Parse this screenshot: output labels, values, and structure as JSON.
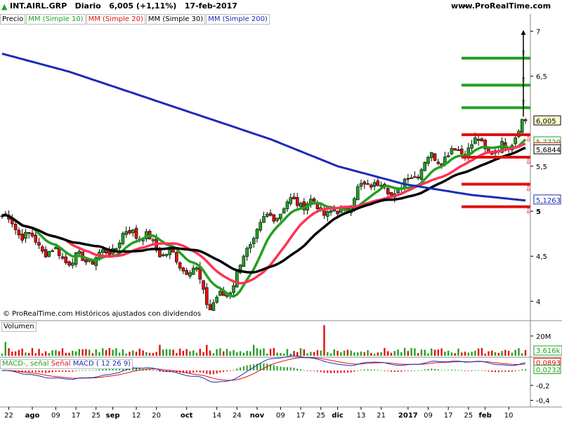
{
  "header": {
    "symbol": "INT.AIRL.GRP",
    "period": "Diario",
    "price_change": "6,005 (+1,11%)",
    "date": "17-feb-2017",
    "site": "www.ProRealTime.com"
  },
  "legend": {
    "price": "Precio",
    "ma10": "MM (Simple 10)",
    "ma20": "MM (Simple 20)",
    "ma30": "MM (Simple 30)",
    "ma200": "MM (Simple 200)"
  },
  "copyright": "© ProRealTime.com  Históricos ajustados con dividendos",
  "volume_label": "Volumen",
  "macd_labels": {
    "macd_signal": "MACD-, señal",
    "signal": "Señal",
    "macd": "MACD ( 12 26 9)"
  },
  "colors": {
    "up": "#22a022",
    "down": "#e01010",
    "ma10": "#22a022",
    "ma20": "#ff3355",
    "ma30": "#000000",
    "ma200": "#1c2bb8"
  },
  "chart_data": {
    "type": "line",
    "price_axis": {
      "ticks": [
        {
          "value": 7,
          "label": "7"
        },
        {
          "value": 6.5,
          "label": "6,5"
        },
        {
          "value": 5.5,
          "label": "5,5"
        },
        {
          "value": 5,
          "label": "5"
        },
        {
          "value": 4.5,
          "label": "4,5"
        },
        {
          "value": 4,
          "label": "4"
        }
      ],
      "ylim": [
        3.8,
        7.05
      ]
    },
    "price_tags": [
      {
        "value": 6.005,
        "label": "6,005",
        "color": "#000000",
        "bg": "#ffffcc"
      },
      {
        "value": 5.772,
        "label": "5,7720",
        "color": "#22a022",
        "bg": "#ffffff"
      },
      {
        "value": 5.7383,
        "label": "5,7383",
        "color": "#e01010",
        "bg": "#ffffff"
      },
      {
        "value": 5.6844,
        "label": "5,6844",
        "color": "#000000",
        "bg": "#ffffff"
      },
      {
        "value": 5.1263,
        "label": "5,1263",
        "color": "#1c2bb8",
        "bg": "#ffffff"
      }
    ],
    "x_axis": [
      {
        "label": "22",
        "i": 2
      },
      {
        "label": "ago",
        "i": 9
      },
      {
        "label": "09",
        "i": 16
      },
      {
        "label": "17",
        "i": 22
      },
      {
        "label": "25",
        "i": 28
      },
      {
        "label": "sep",
        "i": 33
      },
      {
        "label": "12",
        "i": 40
      },
      {
        "label": "20",
        "i": 46
      },
      {
        "label": "oct",
        "i": 55
      },
      {
        "label": "14",
        "i": 64
      },
      {
        "label": "24",
        "i": 70
      },
      {
        "label": "nov",
        "i": 76
      },
      {
        "label": "09",
        "i": 83
      },
      {
        "label": "17",
        "i": 89
      },
      {
        "label": "25",
        "i": 95
      },
      {
        "label": "dic",
        "i": 100
      },
      {
        "label": "13",
        "i": 107
      },
      {
        "label": "21",
        "i": 113
      },
      {
        "label": "2017",
        "i": 121
      },
      {
        "label": "09",
        "i": 127
      },
      {
        "label": "17",
        "i": 133
      },
      {
        "label": "25",
        "i": 139
      },
      {
        "label": "feb",
        "i": 144
      },
      {
        "label": "10",
        "i": 151
      }
    ],
    "bars": 157,
    "keypoints": [
      [
        0,
        4.95
      ],
      [
        8,
        4.7
      ],
      [
        14,
        4.55
      ],
      [
        22,
        4.45
      ],
      [
        30,
        4.5
      ],
      [
        39,
        4.8
      ],
      [
        46,
        4.6
      ],
      [
        52,
        4.45
      ],
      [
        58,
        4.3
      ],
      [
        62,
        3.95
      ],
      [
        66,
        4.05
      ],
      [
        70,
        4.3
      ],
      [
        76,
        4.8
      ],
      [
        82,
        5.0
      ],
      [
        88,
        5.12
      ],
      [
        94,
        5.05
      ],
      [
        100,
        4.95
      ],
      [
        106,
        5.2
      ],
      [
        110,
        5.35
      ],
      [
        116,
        5.2
      ],
      [
        120,
        5.3
      ],
      [
        126,
        5.55
      ],
      [
        134,
        5.65
      ],
      [
        142,
        5.75
      ],
      [
        148,
        5.65
      ],
      [
        152,
        5.82
      ],
      [
        156,
        6.0
      ]
    ],
    "lines": [
      {
        "name": "MM (Simple 10)",
        "period": 10
      },
      {
        "name": "MM (Simple 20)",
        "period": 20
      },
      {
        "name": "MM (Simple 30)",
        "period": 30
      },
      {
        "name": "MM (Simple 200)",
        "keypoints": [
          [
            0,
            6.75
          ],
          [
            20,
            6.55
          ],
          [
            40,
            6.3
          ],
          [
            60,
            6.05
          ],
          [
            80,
            5.8
          ],
          [
            100,
            5.5
          ],
          [
            120,
            5.3
          ],
          [
            140,
            5.18
          ],
          [
            156,
            5.12
          ]
        ]
      }
    ],
    "levels_green": [
      6.7,
      6.4,
      6.15
    ],
    "levels_red": [
      5.85,
      5.6,
      5.3,
      5.05
    ],
    "volume": {
      "label": "Volumen",
      "ticks": [
        {
          "value": 20,
          "label": "20M"
        }
      ],
      "last_label": "3.616k",
      "ylim": [
        0,
        32
      ]
    },
    "macd": {
      "label": "MACD ( 12 26 9)",
      "ticks": [
        {
          "value": -0.2,
          "label": "-0,2"
        },
        {
          "value": -0.4,
          "label": "-0,4"
        }
      ],
      "tags": [
        {
          "value": 0.0893,
          "label": "0,0893",
          "color": "#e01010"
        },
        {
          "value": 0.0232,
          "label": "0,0232",
          "color": "#22a022"
        }
      ],
      "ylim": [
        -0.48,
        0.16
      ]
    }
  }
}
